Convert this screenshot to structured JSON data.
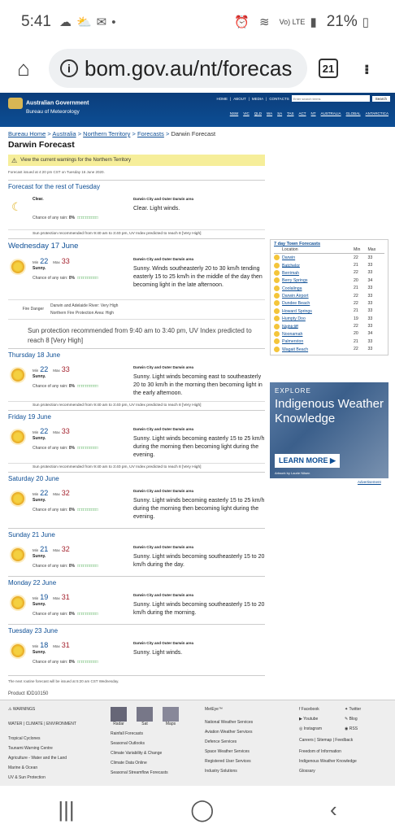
{
  "status": {
    "time": "5:41",
    "battery": "21%",
    "volte": "Vo) LTE"
  },
  "browser": {
    "url": "bom.gov.au/nt/forecas",
    "tabs": "21"
  },
  "header": {
    "gov": "Australian Government",
    "bureau": "Bureau of Meteorology",
    "links": [
      "HOME",
      "ABOUT",
      "MEDIA",
      "CONTACTS"
    ],
    "search_placeholder": "Enter search terms",
    "search_btn": "Search",
    "states": [
      "NSW",
      "VIC",
      "QLD",
      "WA",
      "SA",
      "TAS",
      "ACT",
      "NT",
      "AUSTRALIA",
      "GLOBAL",
      "ANTARCTICA"
    ]
  },
  "breadcrumb": {
    "c1": "Bureau Home",
    "c2": "Australia",
    "c3": "Northern Territory",
    "c4": "Forecasts",
    "current": "Darwin Forecast"
  },
  "title": "Darwin Forecast",
  "warning": "View the current warnings for the Northern Territory",
  "issued": "Forecast issued at 4:20 pm CST on Tuesday 16 June 2020.",
  "tonight": {
    "head": "Forecast for the rest of Tuesday",
    "cond": "Clear.",
    "rain": "0%",
    "area": "Darwin City and Outer Darwin area",
    "text": "Clear. Light winds.",
    "sun": "Sun protection recommended from 9:40 am to 3:40 pm, UV Index predicted to reach 8 [Very High]"
  },
  "labels": {
    "min": "Min",
    "max": "Max",
    "chance": "Chance of any rain:",
    "fire": "Fire Danger"
  },
  "days": [
    {
      "head": "Wednesday 17 June",
      "min": "22",
      "max": "33",
      "cond": "Sunny.",
      "rain": "0%",
      "area": "Darwin City and Outer Darwin area",
      "text": "Sunny. Winds southeasterly 20 to 30 km/h tending easterly 15 to 25 km/h in the middle of the day then becoming light in the late afternoon.",
      "fire1": "Darwin and Adelaide River: Very High",
      "fire2": "Northern Fire Protection Area: High",
      "sun": "Sun protection recommended from 9:40 am to 3:40 pm, UV Index predicted to reach 8 [Very High]"
    },
    {
      "head": "Thursday 18 June",
      "min": "22",
      "max": "33",
      "cond": "Sunny.",
      "rain": "0%",
      "area": "Darwin City and Outer Darwin area",
      "text": "Sunny. Light winds becoming east to southeasterly 20 to 30 km/h in the morning then becoming light in the early afternoon.",
      "sun": "Sun protection recommended from 9:40 am to 3:40 pm, UV Index predicted to reach 8 [Very High]"
    },
    {
      "head": "Friday 19 June",
      "min": "22",
      "max": "33",
      "cond": "Sunny.",
      "rain": "0%",
      "area": "Darwin City and Outer Darwin area",
      "text": "Sunny. Light winds becoming easterly 15 to 25 km/h during the morning then becoming light during the evening.",
      "sun": "Sun protection recommended from 9:40 am to 3:40 pm, UV Index predicted to reach 8 [Very High]"
    },
    {
      "head": "Saturday 20 June",
      "min": "22",
      "max": "32",
      "cond": "Sunny.",
      "rain": "0%",
      "area": "Darwin City and Outer Darwin area",
      "text": "Sunny. Light winds becoming easterly 15 to 25 km/h during the morning then becoming light during the evening."
    },
    {
      "head": "Sunday 21 June",
      "min": "21",
      "max": "32",
      "cond": "Sunny.",
      "rain": "0%",
      "area": "Darwin City and Outer Darwin area",
      "text": "Sunny. Light winds becoming southeasterly 15 to 20 km/h during the day."
    },
    {
      "head": "Monday 22 June",
      "min": "19",
      "max": "31",
      "cond": "Sunny.",
      "rain": "0%",
      "area": "Darwin City and Outer Darwin area",
      "text": "Sunny. Light winds becoming southeasterly 15 to 20 km/h during the morning."
    },
    {
      "head": "Tuesday 23 June",
      "min": "18",
      "max": "31",
      "cond": "Sunny.",
      "rain": "0%",
      "area": "Darwin City and Outer Darwin area",
      "text": "Sunny. Light winds."
    }
  ],
  "next": "The next routine forecast will be issued at 5:20 am CST Wednesday.",
  "product": "Product IDD10150",
  "towns": {
    "title": "7 day Town Forecasts",
    "cols": [
      "Location",
      "Min",
      "Max"
    ],
    "rows": [
      [
        "Darwin",
        "22",
        "33"
      ],
      [
        "Batchelor",
        "21",
        "33"
      ],
      [
        "Berrimah",
        "22",
        "33"
      ],
      [
        "Berry Springs",
        "20",
        "34"
      ],
      [
        "Coolalinga",
        "21",
        "33"
      ],
      [
        "Darwin Airport",
        "22",
        "33"
      ],
      [
        "Dundee Beach",
        "22",
        "33"
      ],
      [
        "Howard Springs",
        "21",
        "33"
      ],
      [
        "Humpty Doo",
        "19",
        "33"
      ],
      [
        "Nightcliff",
        "22",
        "33"
      ],
      [
        "Noonamah",
        "20",
        "34"
      ],
      [
        "Palmerston",
        "21",
        "33"
      ],
      [
        "Wagait Beach",
        "22",
        "33"
      ]
    ]
  },
  "ad": {
    "explore": "EXPLORE",
    "line": "Indigenous Weather Knowledge",
    "btn": "LEARN MORE",
    "art": "Artwork by Laurie Nilsen",
    "advert": "Advertisement"
  },
  "footer": {
    "warnings": "WARNINGS",
    "water": "WATER",
    "climate": "CLIMATE",
    "environment": "ENVIRONMENT",
    "col1": [
      "Tropical Cyclones",
      "Tsunami Warning Centre",
      "Agriculture - Water and the Land",
      "Marine & Ocean",
      "UV & Sun Protection"
    ],
    "icons": [
      "Radar",
      "Sat",
      "Maps"
    ],
    "col2": [
      "Rainfall Forecasts",
      "Seasonal Outlooks",
      "Climate Variability & Change",
      "Climate Data Online",
      "Seasonal Streamflow Forecasts"
    ],
    "meteye": "MetEye™",
    "col3": [
      "National Weather Services",
      "Aviation Weather Services",
      "Defence Services",
      "Space Weather Services",
      "Registered User Services",
      "Industry Solutions"
    ],
    "social": [
      "Facebook",
      "Twitter",
      "Youtube",
      "Blog",
      "Instagram",
      "RSS"
    ],
    "col4": [
      "Careers",
      "Sitemap",
      "Feedback",
      "Freedom of Information",
      "Indigenous Weather Knowledge",
      "Glossary"
    ]
  }
}
